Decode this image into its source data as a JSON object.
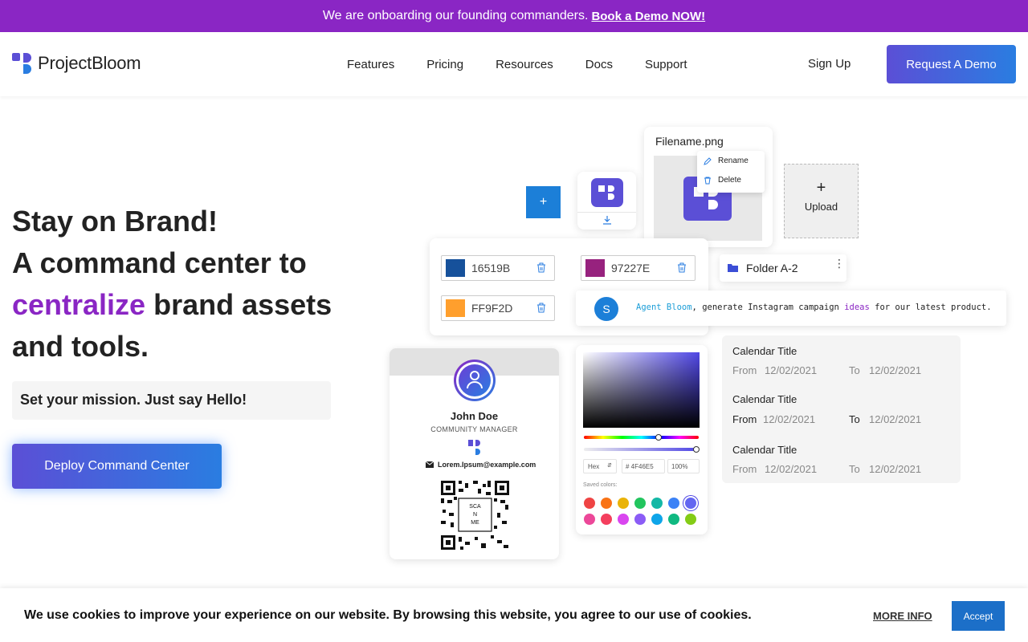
{
  "announcement": {
    "text": "We are onboarding our founding commanders.",
    "link": "Book a Demo NOW!"
  },
  "nav": {
    "logo_prefix": "Project",
    "logo_suffix": "Bloom",
    "items": [
      "Features",
      "Pricing",
      "Resources",
      "Docs",
      "Support"
    ],
    "signup": "Sign Up",
    "demo_button": "Request A Demo"
  },
  "hero": {
    "line1": "Stay on Brand!",
    "line2": "A command center to",
    "accent": "centralize",
    "line3_rest": " brand assets",
    "line4": "and tools.",
    "mission": "Set your mission. Just say Hello!",
    "cta": "Deploy Command Center"
  },
  "illustration": {
    "plus_button": "+",
    "file_card": {
      "title": "Filename.png",
      "menu": [
        "Rename",
        "Delete"
      ]
    },
    "upload": {
      "plus": "+",
      "label": "Upload"
    },
    "swatches": [
      {
        "hex": "16519B",
        "color": "#16519b"
      },
      {
        "hex": "97227E",
        "color": "#97227e"
      },
      {
        "hex": "FF9F2D",
        "color": "#ff9f2d"
      }
    ],
    "folder": "Folder A-2",
    "agent": {
      "avatar": "S",
      "name": "Agent Bloom",
      "prompt_before": ", generate Instagram campaign ",
      "keyword": "ideas",
      "prompt_after": " for our latest product."
    },
    "id_card": {
      "name": "John Doe",
      "role": "COMMUNITY MANAGER",
      "email": "Lorem.Ipsum@example.com",
      "qr_text": [
        "SCA",
        "N",
        "ME"
      ]
    },
    "picker": {
      "mode": "Hex",
      "value": "# 4F46E5",
      "alpha": "100%",
      "saved_label": "Saved colors:",
      "saved_colors": [
        "#ef4444",
        "#f97316",
        "#eab308",
        "#22c55e",
        "#14b8a6",
        "#3b82f6",
        "#6366f1",
        "#ec4899",
        "#f43f5e",
        "#d946ef",
        "#8b5cf6",
        "#0ea5e9",
        "#10b981",
        "#84cc16"
      ]
    },
    "calendar": [
      {
        "title": "Calendar Title",
        "from_label": "From",
        "from": "12/02/2021",
        "to_label": "To",
        "to": "12/02/2021"
      },
      {
        "title": "Calendar Title",
        "from_label": "From",
        "from": "12/02/2021",
        "to_label": "To",
        "to": "12/02/2021"
      },
      {
        "title": "Calendar Title",
        "from_label": "From",
        "from": "12/02/2021",
        "to_label": "To",
        "to": "12/02/2021"
      }
    ]
  },
  "cookie": {
    "text": "We use cookies to improve your experience on our website. By browsing this website, you agree to our use of cookies.",
    "more_info": "MORE INFO",
    "accept": "Accept"
  },
  "colors": {
    "brand_purple": "#8a26c4",
    "brand_blue": "#2a7de1",
    "indigo": "#5b4fd6"
  }
}
